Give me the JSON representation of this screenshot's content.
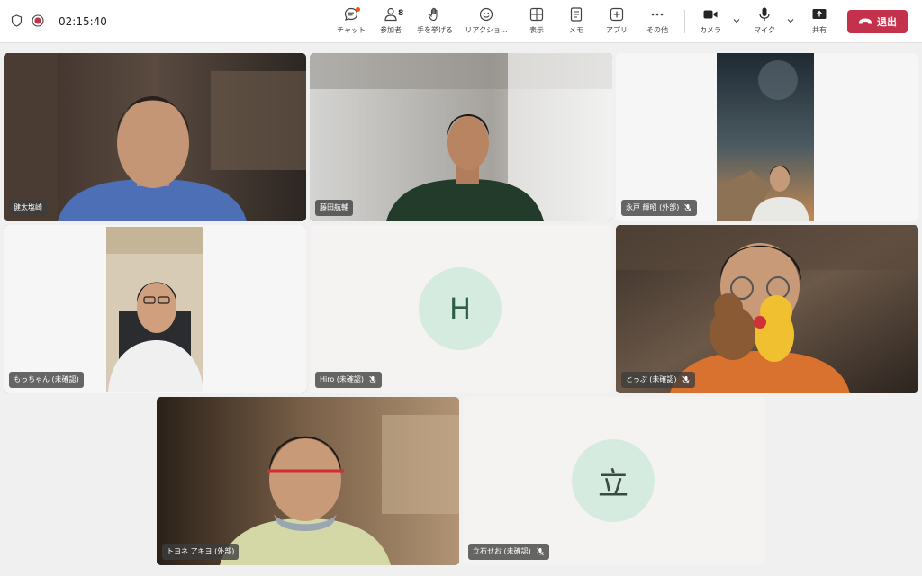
{
  "status": {
    "timer": "02:15:40"
  },
  "toolbar": {
    "chat": "チャット",
    "participants": "参加者",
    "participants_count": "8",
    "raise_hand": "手を挙げる",
    "reactions": "リアクショ...",
    "view": "表示",
    "notes": "メモ",
    "apps": "アプリ",
    "more": "その他",
    "camera": "カメラ",
    "mic": "マイク",
    "share": "共有",
    "leave": "退出"
  },
  "colors": {
    "leave": "#c4314b",
    "selected_outline": "#5b5fc7",
    "avatar_bg": "#d6ebe0",
    "avatar_fg": "#2f5e46"
  },
  "participants": [
    {
      "name": "健太塩崎",
      "muted": false
    },
    {
      "name": "藤田航輔",
      "muted": false
    },
    {
      "name": "永戸 輝昭 (外部)",
      "muted": true
    },
    {
      "name": "もっちゃん (未確認)",
      "muted": false,
      "selected": true
    },
    {
      "name": "Hiro (未確認)",
      "muted": true,
      "avatar": "H"
    },
    {
      "name": "とっぷ (未確認)",
      "muted": true
    },
    {
      "name": "トヨネ アキヨ (外部)",
      "muted": false
    },
    {
      "name": "立石せお (未確認)",
      "muted": true,
      "avatar": "立"
    }
  ]
}
